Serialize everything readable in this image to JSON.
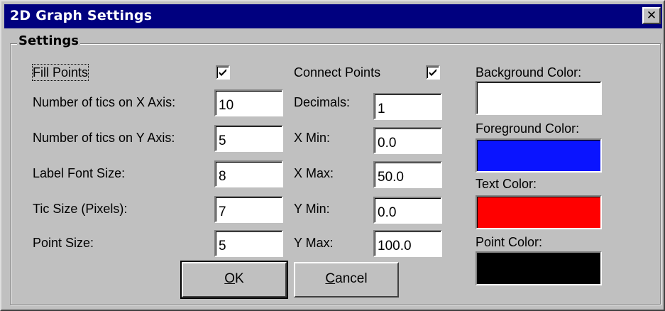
{
  "window": {
    "title": "2D Graph Settings",
    "close_glyph": "✕"
  },
  "group": {
    "label": "Settings"
  },
  "left": {
    "fill_points_label": "Fill Points",
    "fill_points_checked": true,
    "fields": [
      {
        "label": "Number of tics on X Axis:",
        "value": "10"
      },
      {
        "label": "Number of tics on Y Axis:",
        "value": "5"
      },
      {
        "label": "Label Font Size:",
        "value": "8"
      },
      {
        "label": "Tic Size (Pixels):",
        "value": "7"
      },
      {
        "label": "Point Size:",
        "value": "5"
      }
    ]
  },
  "middle": {
    "connect_points_label": "Connect Points",
    "connect_points_checked": true,
    "fields": [
      {
        "label": "Decimals:",
        "value": "1"
      },
      {
        "label": "X Min:",
        "value": "0.0"
      },
      {
        "label": "X Max:",
        "value": "50.0"
      },
      {
        "label": "Y Min:",
        "value": "0.0"
      },
      {
        "label": "Y Max:",
        "value": "100.0"
      }
    ]
  },
  "colors": [
    {
      "label": "Background Color:",
      "color": "#ffffff"
    },
    {
      "label": "Foreground Color:",
      "color": "#0a14ff"
    },
    {
      "label": "Text Color:",
      "color": "#ff0000"
    },
    {
      "label": "Point Color:",
      "color": "#000000"
    }
  ],
  "buttons": {
    "ok_mnemonic": "O",
    "ok_rest": "K",
    "cancel_mnemonic": "C",
    "cancel_rest": "ancel"
  }
}
